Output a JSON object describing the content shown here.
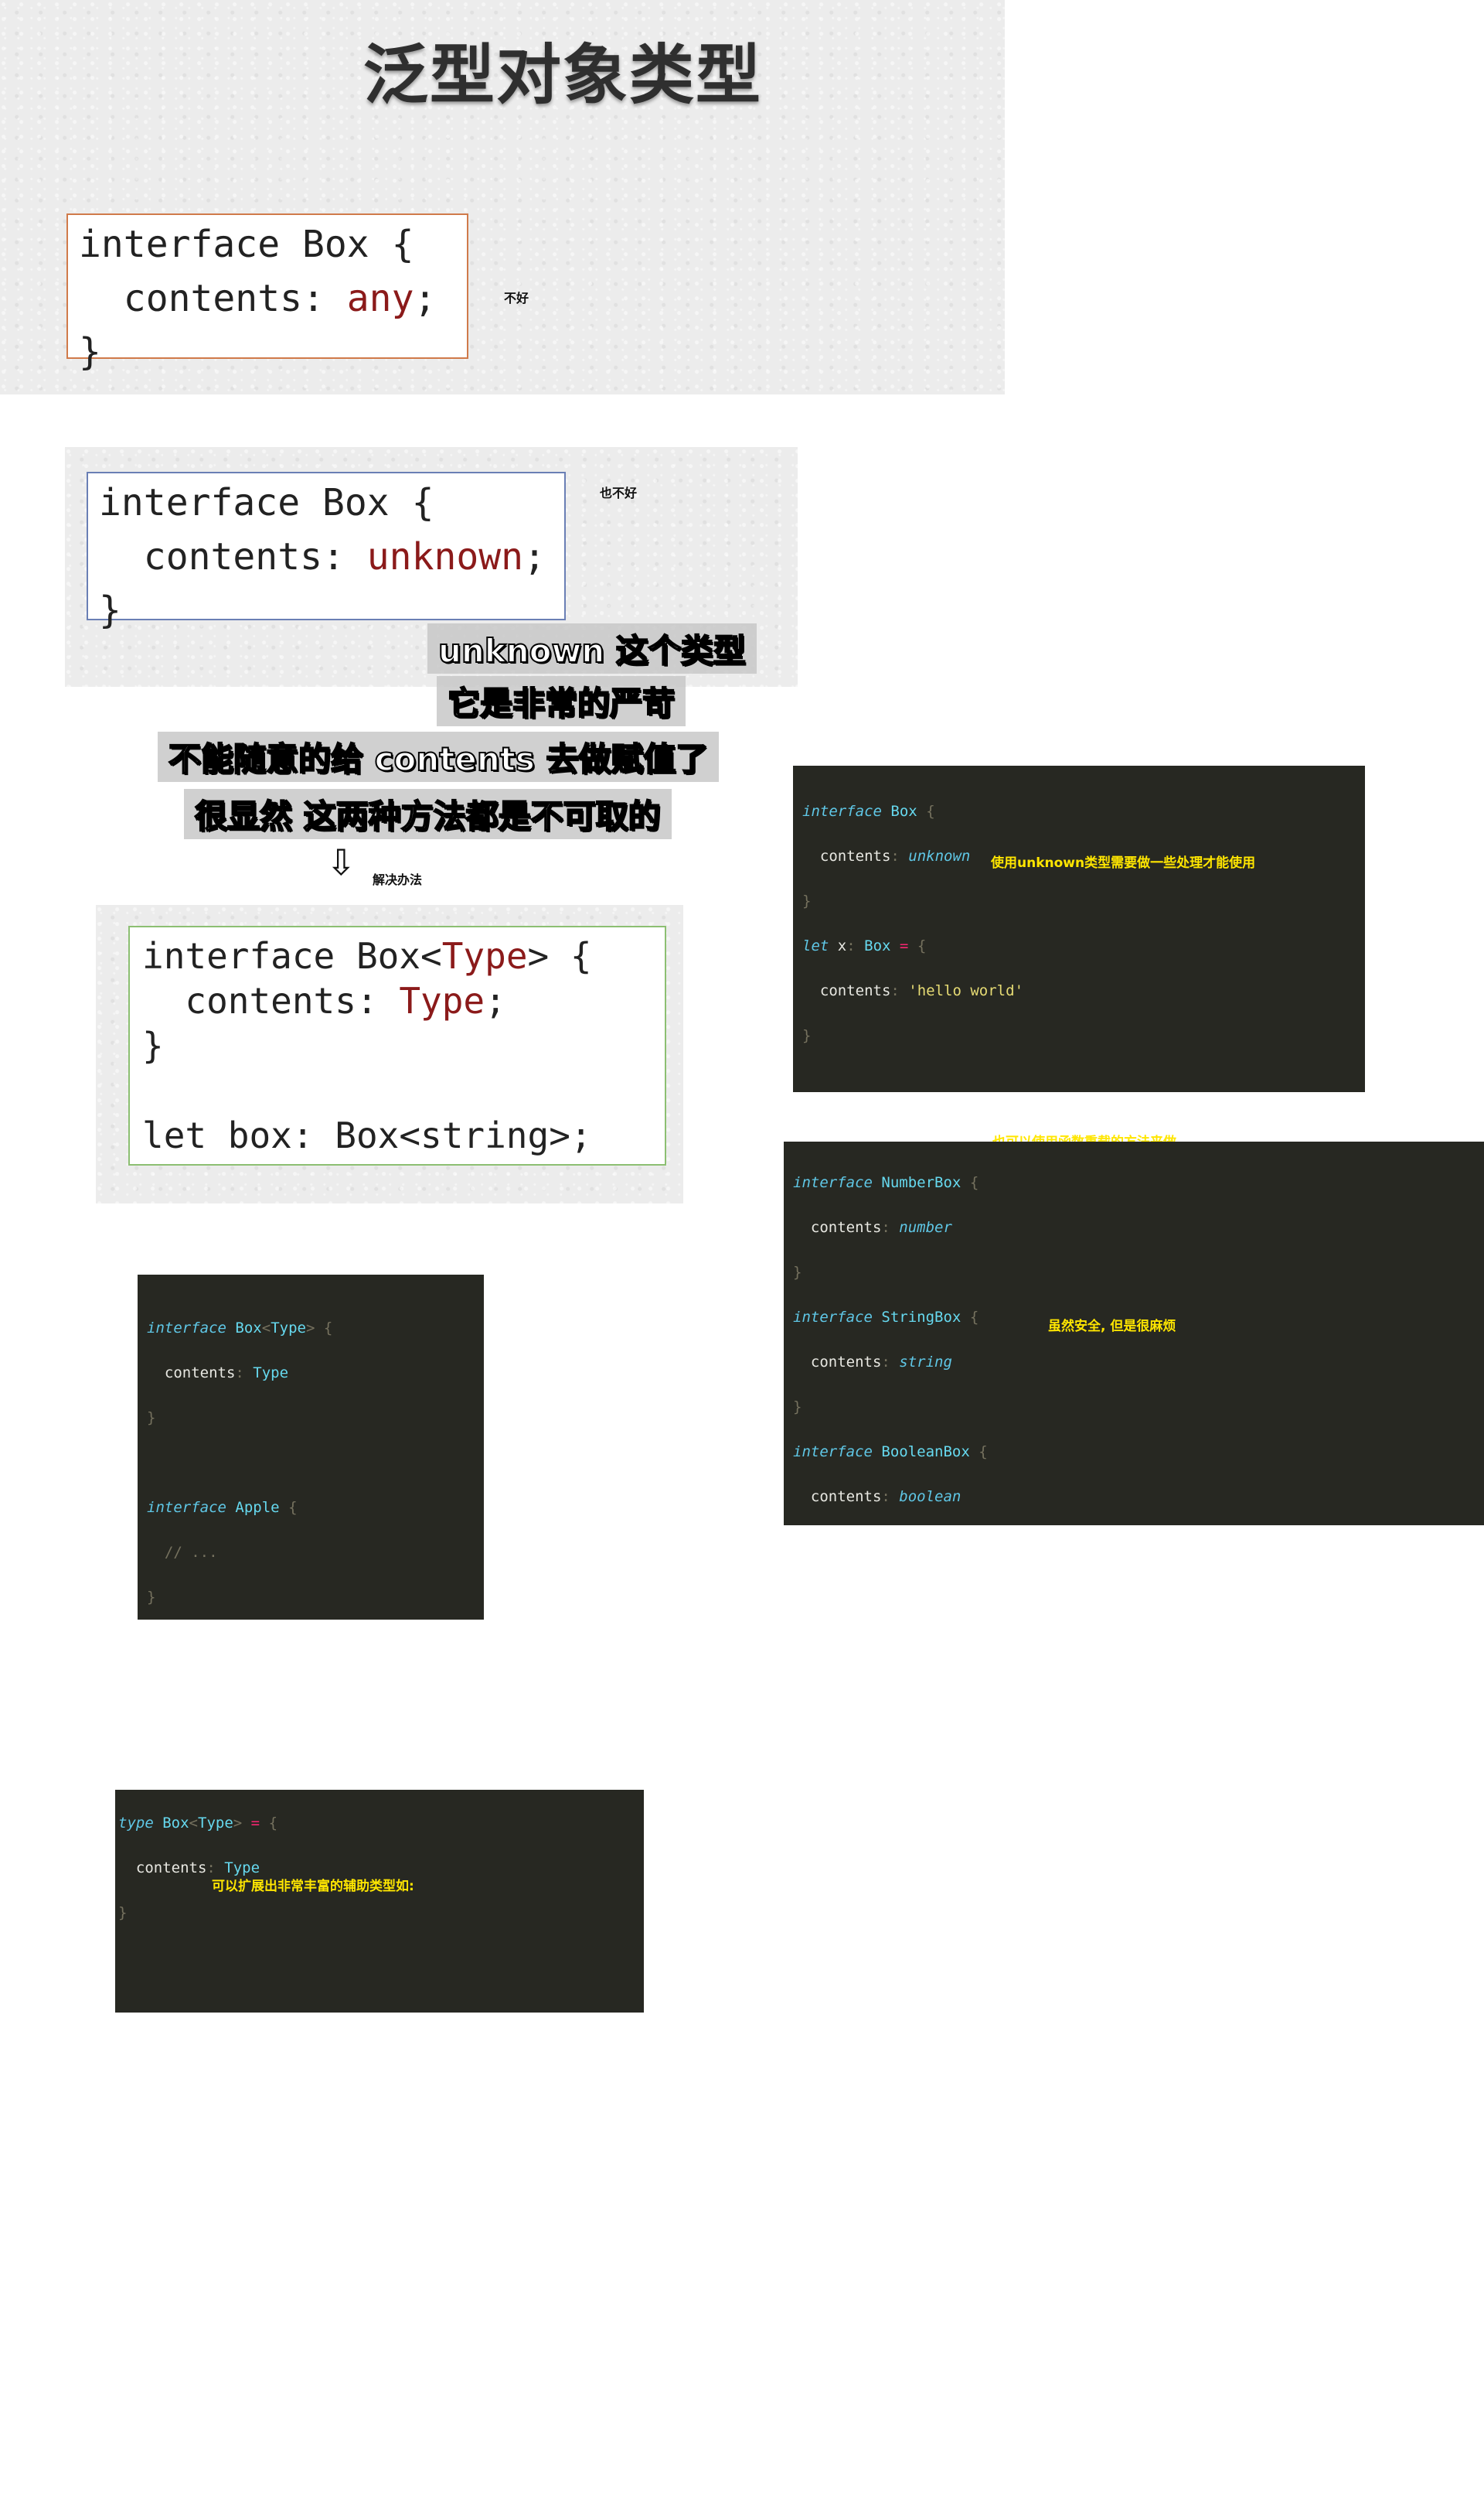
{
  "page": {
    "title": "泛型对象类型"
  },
  "slide1": {
    "code_lines": [
      "interface Box {",
      "  contents: ",
      "}"
    ],
    "any_keyword": "any",
    "semicolon": ";",
    "note": "不好"
  },
  "slide2": {
    "code_lines": [
      "interface Box {",
      "  contents: ",
      "}"
    ],
    "unknown_keyword": "unknown",
    "semicolon": ";",
    "note": "也不好"
  },
  "subtitles": [
    "unknown 这个类型",
    "它是非常的严苛",
    "不能随意的给 contents 去做赋值了",
    "很显然 这两种方法都是不可取的"
  ],
  "solution": {
    "note": "解决办法",
    "arrow_icon": "down-arrow-icon",
    "line1_a": "interface Box<",
    "line1_type": "Type",
    "line1_b": "> {",
    "line2_a": "  contents: ",
    "line2_type": "Type",
    "line2_b": ";",
    "line3": "}",
    "line5": "let box: Box<string>;"
  },
  "panel_unknown": {
    "note": "使用unknown类型需要做一些处理才能使用"
  },
  "panel_overload": {
    "note_top": "也可以使用函数重载的方法来做",
    "note_mid": "虽然安全, 但是很麻烦"
  },
  "panel_helpers": {
    "note": "可以扩展出非常丰富的辅助类型如:"
  },
  "colors": {
    "editor_bg": "#272822",
    "keyword": "#5fc7e6",
    "string": "#e6db74",
    "function": "#a6e22e",
    "param": "#fd971f",
    "operator": "#f92672",
    "note_yellow": "#ffe600",
    "any_red": "#8b1a1a"
  }
}
